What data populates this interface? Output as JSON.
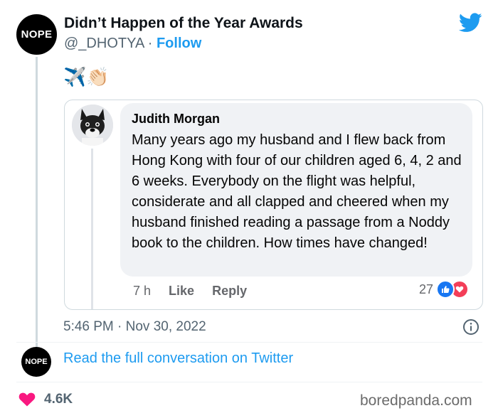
{
  "tweet": {
    "avatar_text": "NOPE",
    "display_name": "Didn’t Happen of the Year Awards",
    "handle": "@_DHOTYA",
    "separator": " · ",
    "follow_label": "Follow",
    "emojis": "✈️👏🏻",
    "timestamp": "5:46 PM · Nov 30, 2022",
    "read_link": "Read the full conversation on Twitter",
    "small_avatar_text": "NOPE",
    "like_count": "4.6K"
  },
  "embedded_comment": {
    "name": "Judith Morgan",
    "text": "Many years ago my husband and I flew back from Hong Kong with four of our children aged 6, 4, 2 and 6 weeks. Everybody on the flight was helpful, considerate and all clapped and cheered when my husband finished reading a passage from a Noddy book to the children. How times have changed!",
    "time": "7 h",
    "like_label": "Like",
    "reply_label": "Reply",
    "reaction_count": "27",
    "reactions": [
      "like-icon",
      "love-icon"
    ]
  },
  "watermark": "boredpanda.com",
  "colors": {
    "twitter_blue": "#1d9bf0",
    "heart": "#f91880",
    "fb_like": "#1877f2",
    "fb_love": "#f33e58",
    "bubble_bg": "#f0f2f5"
  }
}
